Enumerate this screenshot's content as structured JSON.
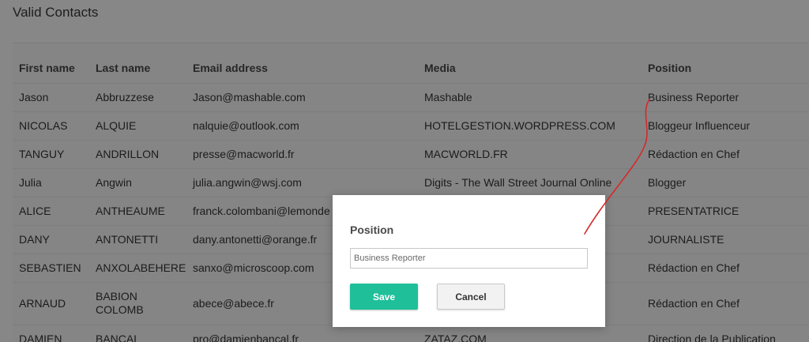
{
  "page": {
    "title": "Valid Contacts"
  },
  "table": {
    "headers": [
      "First name",
      "Last name",
      "Email address",
      "Media",
      "Position"
    ],
    "rows": [
      [
        "Jason",
        "Abbruzzese",
        "Jason@mashable.com",
        "Mashable",
        "Business Reporter"
      ],
      [
        "NICOLAS",
        "ALQUIE",
        "nalquie@outlook.com",
        "HOTELGESTION.WORDPRESS.COM",
        "Bloggeur Influenceur"
      ],
      [
        "TANGUY",
        "ANDRILLON",
        "presse@macworld.fr",
        "MACWORLD.FR",
        "Rédaction en Chef"
      ],
      [
        "Julia",
        "Angwin",
        "julia.angwin@wsj.com",
        "Digits - The Wall Street Journal Online",
        "Blogger"
      ],
      [
        "ALICE",
        "ANTHEAUME",
        "franck.colombani@lemonde",
        "",
        "PRESENTATRICE"
      ],
      [
        "DANY",
        "ANTONETTI",
        "dany.antonetti@orange.fr",
        "",
        "JOURNALISTE"
      ],
      [
        "SEBASTIEN",
        "ANXOLABEHERE",
        "sanxo@microscoop.com",
        "",
        "Rédaction en Chef"
      ],
      [
        "ARNAUD",
        "BABION COLOMB",
        "abece@abece.fr",
        "",
        "Rédaction en Chef"
      ],
      [
        "DAMIEN",
        "BANCAL",
        "pro@damienbancal.fr",
        "ZATAZ.COM",
        "Direction de la Publication"
      ]
    ]
  },
  "modal": {
    "label": "Position",
    "input_value": "Business Reporter",
    "save_label": "Save",
    "cancel_label": "Cancel"
  },
  "colors": {
    "overlay": "#878787",
    "accent": "#1fbf9a",
    "annotation": "#d42a2a"
  }
}
